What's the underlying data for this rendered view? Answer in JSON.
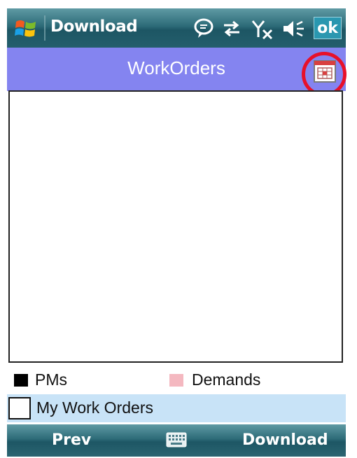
{
  "titlebar": {
    "app_title": "Download",
    "ok_label": "ok",
    "icons": [
      "windows-start-icon",
      "notification-icon",
      "connectivity-icon",
      "signal-no-service-icon",
      "volume-icon"
    ]
  },
  "header": {
    "title": "WorkOrders",
    "calendar_icon": "calendar-icon"
  },
  "legend": {
    "items": [
      {
        "label": "PMs",
        "color": "#000000"
      },
      {
        "label": "Demands",
        "color": "#f4b8c0"
      }
    ]
  },
  "filter": {
    "label": "My Work Orders",
    "checked": false
  },
  "softkeys": {
    "left": "Prev",
    "right": "Download",
    "center_icon": "keyboard-icon"
  },
  "colors": {
    "header_bg": "#8484f0",
    "highlight": "#e8102a",
    "checkbox_row_bg": "#c8e3f7"
  }
}
